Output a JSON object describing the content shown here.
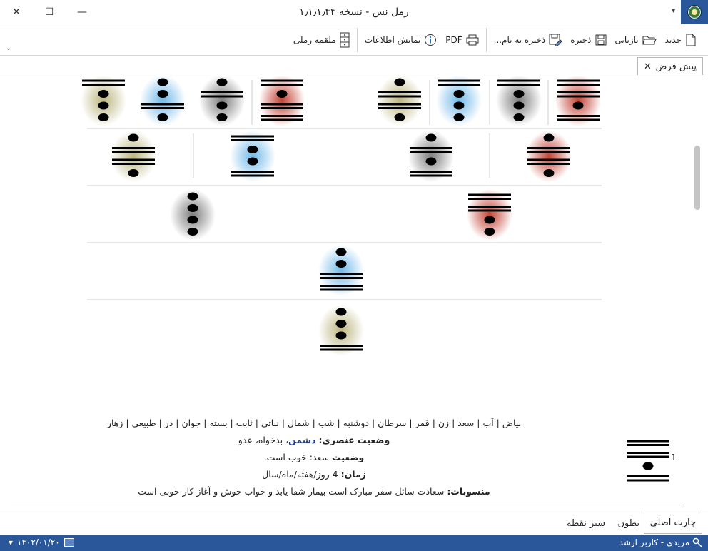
{
  "window": {
    "title": "رمل نس - نسخه ۱٫۱٫۱٫۴۴",
    "close_glyph": "✕",
    "maximize_glyph": "☐",
    "minimize_glyph": "—",
    "qa_glyph": "▾"
  },
  "ribbon": {
    "new_label": "جدید",
    "open_label": "بازیابی",
    "save_label": "ذخیره",
    "save_as_label": "ذخیره به نام...",
    "pdf_label": "PDF",
    "info_label": "نمایش اطلاعات",
    "table_label": "ملقمه رملی",
    "collapse_glyph": "⌄"
  },
  "doc_tab": {
    "label": "پیش فرض",
    "close_glyph": "✕"
  },
  "figure_colors": {
    "red": "#c0392b",
    "gray": "#777777",
    "blue": "#6cb6e8",
    "olive": "#b9b27a"
  },
  "figures": {
    "row1": [
      {
        "lines": [
          2,
          2,
          1,
          2
        ],
        "color": "red"
      },
      {
        "lines": [
          2,
          1,
          1,
          1
        ],
        "color": "gray"
      },
      {
        "lines": [
          2,
          1,
          1,
          1
        ],
        "color": "blue"
      },
      {
        "lines": [
          1,
          2,
          2,
          1
        ],
        "color": "olive"
      },
      {
        "lines": [
          2,
          1,
          2,
          2
        ],
        "color": "red"
      },
      {
        "lines": [
          1,
          2,
          1,
          1
        ],
        "color": "gray"
      },
      {
        "lines": [
          1,
          1,
          2,
          1
        ],
        "color": "blue"
      },
      {
        "lines": [
          2,
          1,
          1,
          1
        ],
        "color": "olive"
      }
    ],
    "row2": [
      {
        "lines": [
          1,
          2,
          2,
          1
        ],
        "color": "red"
      },
      {
        "lines": [
          1,
          2,
          1,
          2
        ],
        "color": "gray"
      },
      {
        "lines": [
          2,
          1,
          1,
          2
        ],
        "color": "blue"
      },
      {
        "lines": [
          1,
          2,
          2,
          1
        ],
        "color": "olive"
      }
    ],
    "row3": [
      {
        "lines": [
          2,
          2,
          1,
          1
        ],
        "color": "red"
      },
      {
        "lines": [
          1,
          1,
          1,
          1
        ],
        "color": "gray"
      }
    ],
    "row4": [
      {
        "lines": [
          1,
          1,
          2,
          2
        ],
        "color": "blue"
      }
    ],
    "row5": [
      {
        "lines": [
          1,
          1,
          1,
          2
        ],
        "color": "olive"
      }
    ],
    "side": {
      "lines": [
        2,
        2,
        1,
        2
      ]
    }
  },
  "info": {
    "attributes": "بیاض | آب | سعد | زن | قمر | سرطان | دوشنبه | شب | شمال | نباتی | ثابت | بسته | جوان | در | طبیعی | زهار",
    "element_label": "وضعیت عنصری:",
    "element_value": "دشمن",
    "element_rest": "، بدخواه، عدو",
    "status_label": "وضعیت",
    "status_value": "سعد: خوب است.",
    "time_label": "زمان:",
    "time_value": "4 روز/هفته/ماه/سال",
    "ascribed_label": "منسوبات:",
    "ascribed_value": "سعادت سائل سفر مبارک است بیمار شفا یابد و خواب خوش و آغاز کار خوبی است"
  },
  "side_number": "1",
  "bottom_tabs": {
    "main": "چارت اصلی",
    "wombs": "بطون",
    "points": "سیر نقطه"
  },
  "status": {
    "user": "مریدی - کاربر ارشد",
    "date": "۱۴۰۲/۰۱/۲۰",
    "date_arrow": "▾"
  }
}
